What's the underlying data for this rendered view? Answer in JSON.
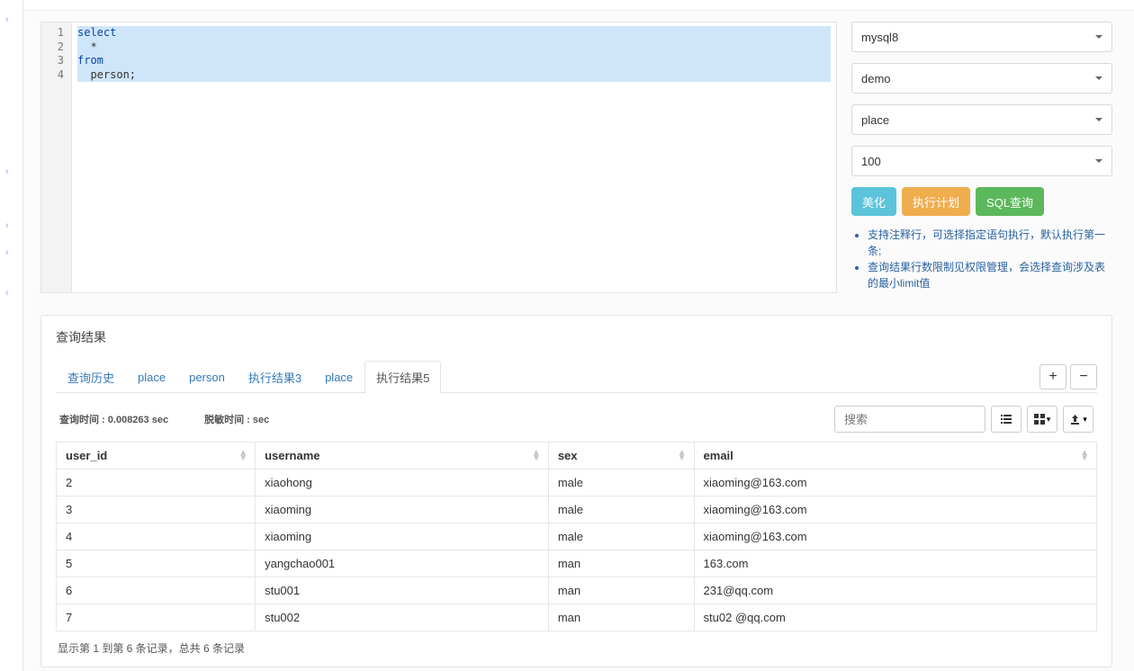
{
  "code": {
    "lines": [
      "1",
      "2",
      "3",
      "4"
    ],
    "line1": "select",
    "line2": "  *",
    "line3": "from",
    "line4": "  person;"
  },
  "controls": {
    "connection": "mysql8",
    "database": "demo",
    "table": "place",
    "limit": "100",
    "btn_beautify": "美化",
    "btn_plan": "执行计划",
    "btn_query": "SQL查询",
    "hint1": "支持注释行，可选择指定语句执行，默认执行第一条;",
    "hint2": "查询结果行数限制见权限管理，会选择查询涉及表的最小limit值"
  },
  "results": {
    "title": "查询结果",
    "tabs": [
      "查询历史",
      "place",
      "person",
      "执行结果3",
      "place",
      "执行结果5"
    ],
    "active_tab_index": 5,
    "meta_query_time_label": "查询时间 : ",
    "meta_query_time_value": "0.008263 sec",
    "meta_mask_time_label": "脱敏时间 : ",
    "meta_mask_time_value": "sec",
    "search_placeholder": "搜索",
    "columns": [
      "user_id",
      "username",
      "sex",
      "email"
    ],
    "rows": [
      {
        "user_id": "2",
        "username": "xiaohong",
        "sex": "male",
        "email": "xiaoming@163.com"
      },
      {
        "user_id": "3",
        "username": "xiaoming",
        "sex": "male",
        "email": "xiaoming@163.com"
      },
      {
        "user_id": "4",
        "username": "xiaoming",
        "sex": "male",
        "email": "xiaoming@163.com"
      },
      {
        "user_id": "5",
        "username": "yangchao001",
        "sex": "man",
        "email": "163.com"
      },
      {
        "user_id": "6",
        "username": "stu001",
        "sex": "man",
        "email": "231@qq.com"
      },
      {
        "user_id": "7",
        "username": " stu002",
        "sex": " man",
        "email": " stu02 @qq.com"
      }
    ],
    "pagination_text": "显示第 1 到第 6 条记录，总共 6 条记录"
  }
}
